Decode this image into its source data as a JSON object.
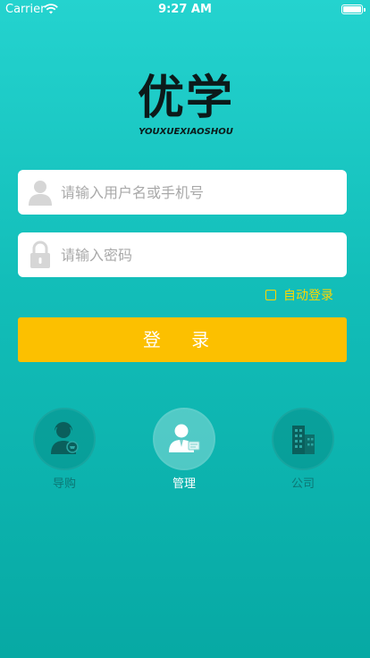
{
  "status_bar": {
    "carrier": "Carrier",
    "time": "9:27 AM"
  },
  "logo": {
    "mark": "优学",
    "subtitle": "YOUXUEXIAOSHOU"
  },
  "form": {
    "username_placeholder": "请输入用户名或手机号",
    "password_placeholder": "请输入密码",
    "auto_login_label": "自动登录",
    "login_button": "登 录"
  },
  "roles": [
    {
      "label": "导购",
      "icon": "shopping-guide-icon",
      "active": false
    },
    {
      "label": "管理",
      "icon": "manager-icon",
      "active": true
    },
    {
      "label": "公司",
      "icon": "company-building-icon",
      "active": false
    }
  ],
  "colors": {
    "background_top": "#24d3cf",
    "background_bottom": "#07a9a4",
    "accent_yellow": "#fcc000",
    "checkbox_yellow": "#ffd700"
  }
}
